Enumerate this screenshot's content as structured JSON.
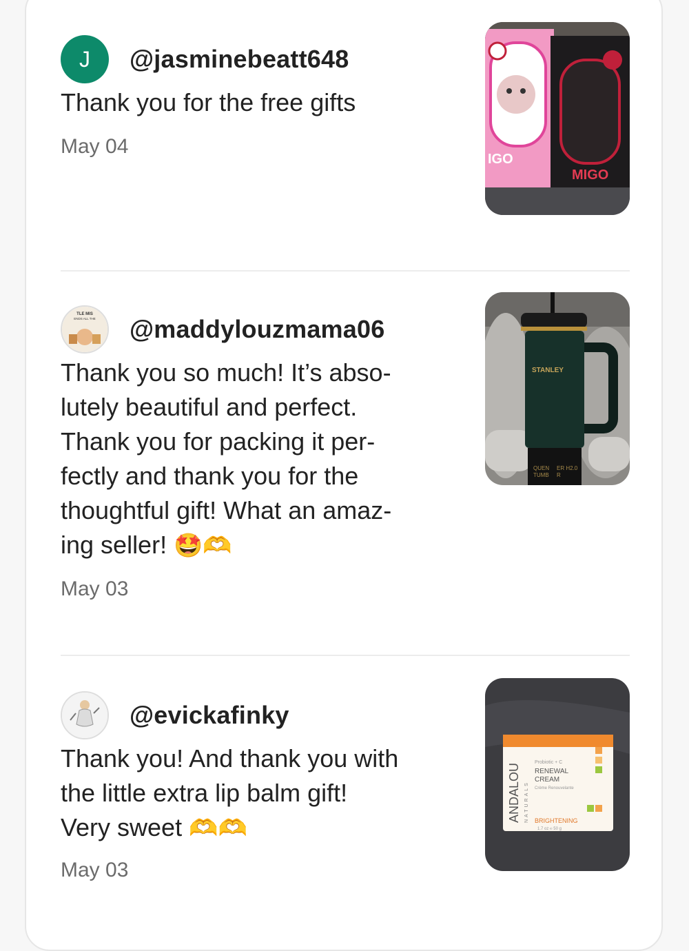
{
  "reviews": [
    {
      "avatar_initial": "J",
      "username": "@jasminebeatt648",
      "text": "Thank you for the free gifts",
      "date": "May 04",
      "photo_labels": [
        "IGO",
        "MIGO"
      ]
    },
    {
      "avatar_text": "TLE MIS ENDS ALL THE ON THE FRENCHES",
      "username": "@maddylouzmama06",
      "text_lines": [
        "Thank you so much! It’s abso-",
        "lutely beautiful and perfect.",
        "Thank you for packing it per-",
        "fectly and thank you for the",
        "thoughtful gift! What an amaz-",
        "ing seller!"
      ],
      "emoji": "🤩🫶",
      "date": "May 03",
      "photo_labels": [
        "STANLEY",
        "QUEN",
        "ER H2.0",
        "TUMB",
        "R"
      ]
    },
    {
      "username": "@evickafinky",
      "text_lines": [
        "Thank you! And thank you with",
        "the little extra lip balm gift!",
        "Very sweet"
      ],
      "emoji": "🫶🫶",
      "date": "May 03",
      "photo_labels": [
        "ANDALOU",
        "NATURALS",
        "Probiotic + C",
        "RENEWAL",
        "CREAM",
        "Crème Renouvelante",
        "BRIGHTENING",
        "1.7 oz ℮ 50 g"
      ]
    }
  ],
  "colors": {
    "avatar_green": "#0d8a6a",
    "text": "#222222",
    "muted": "#6b6b6b",
    "divider": "#ececec"
  }
}
